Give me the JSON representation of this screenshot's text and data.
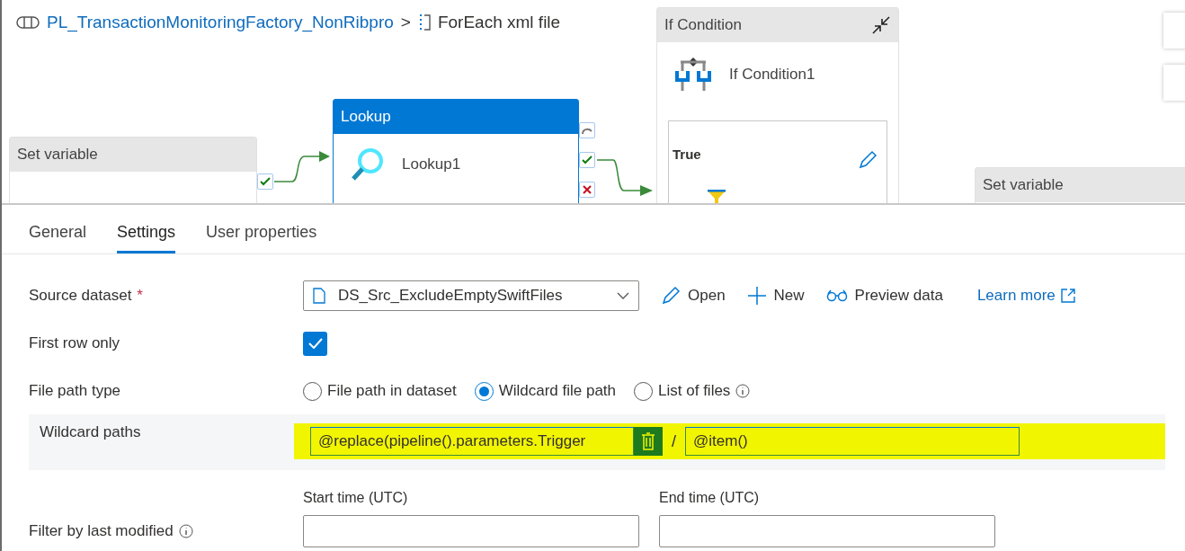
{
  "breadcrumb": {
    "pipeline": "PL_TransactionMonitoringFactory_NonRibpro",
    "separator": ">",
    "activity": "ForEach xml file"
  },
  "canvas": {
    "nodes": [
      {
        "kind": "activity",
        "header": "Set variable",
        "selected": false
      },
      {
        "kind": "activity",
        "header": "Lookup",
        "name": "Lookup1",
        "selected": true
      },
      {
        "kind": "container",
        "header": "If Condition",
        "name": "If Condition1",
        "branch": "True",
        "selected": false
      },
      {
        "kind": "activity",
        "header": "Set variable",
        "selected": false
      }
    ]
  },
  "tabs": [
    {
      "label": "General",
      "selected": false
    },
    {
      "label": "Settings",
      "selected": true
    },
    {
      "label": "User properties",
      "selected": false
    }
  ],
  "settings": {
    "source_dataset": {
      "label": "Source dataset",
      "required_mark": "*",
      "value": "DS_Src_ExcludeEmptySwiftFiles",
      "actions": [
        "Open",
        "New",
        "Preview data"
      ],
      "link": "Learn more"
    },
    "first_row_only": {
      "label": "First row only",
      "checked": true
    },
    "file_path_type": {
      "label": "File path type",
      "options": [
        {
          "label": "File path in dataset",
          "selected": false,
          "info": false
        },
        {
          "label": "Wildcard file path",
          "selected": true,
          "info": false
        },
        {
          "label": "List of files",
          "selected": false,
          "info": true
        }
      ]
    },
    "wildcard_paths": {
      "label": "Wildcard paths",
      "folder": "@replace(pipeline().parameters.Trigger",
      "separator": "/",
      "file": "@item()",
      "highlighted": true
    },
    "filter_by_last_modified": {
      "label": "Filter by last modified",
      "start_label": "Start time (UTC)",
      "end_label": "End time (UTC)"
    }
  }
}
